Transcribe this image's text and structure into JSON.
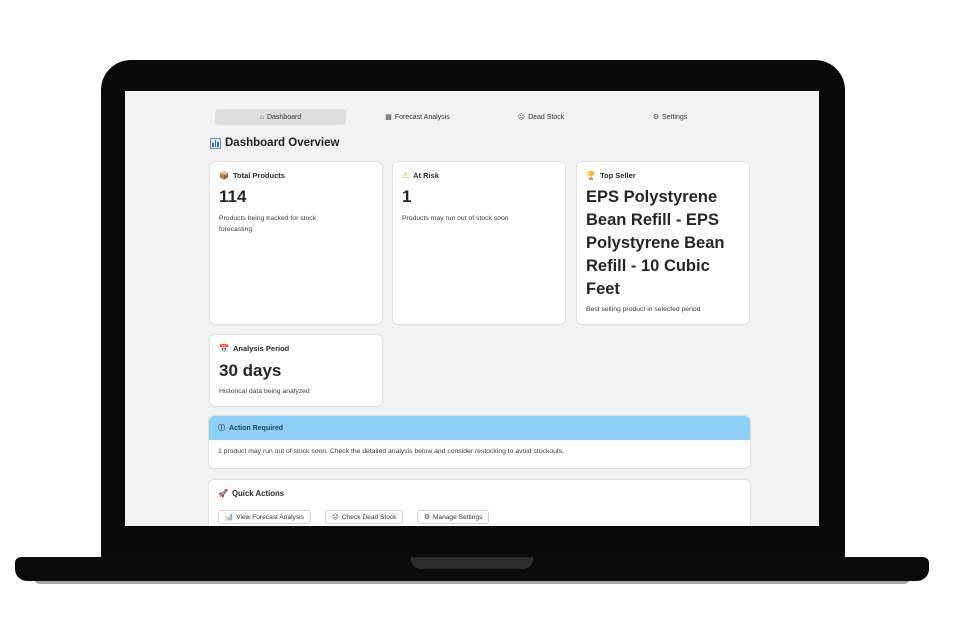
{
  "nav": {
    "tabs": [
      {
        "label": "Dashboard",
        "icon": "home-icon",
        "glyph": "⌂",
        "active": true
      },
      {
        "label": "Forecast Analysis",
        "icon": "chart-icon",
        "glyph": "▦",
        "active": false
      },
      {
        "label": "Dead Stock",
        "icon": "skull-icon",
        "glyph": "☹",
        "active": false
      },
      {
        "label": "Settings",
        "icon": "gear-icon",
        "glyph": "⚙",
        "active": false
      }
    ]
  },
  "page": {
    "title": "Dashboard Overview"
  },
  "cards": {
    "total_products": {
      "title": "Total Products",
      "icon": "package-icon",
      "glyph": "📦",
      "value": "114",
      "description": "Products being tracked for stock forecasting"
    },
    "at_risk": {
      "title": "At Risk",
      "icon": "warning-icon",
      "glyph": "⚠",
      "value": "1",
      "description": "Products may run out of stock soon"
    },
    "top_seller": {
      "title": "Top Seller",
      "icon": "trophy-icon",
      "glyph": "🏆",
      "value": "EPS Polystyrene Bean Refill - EPS Polystyrene Bean Refill - 10 Cubic Feet",
      "description": "Best selling product in selected period"
    },
    "analysis_period": {
      "title": "Analysis Period",
      "icon": "calendar-icon",
      "glyph": "📅",
      "value": "30 days",
      "description": "Historical data being analyzed"
    }
  },
  "alert": {
    "title": "Action Required",
    "icon": "info-icon",
    "glyph": "ⓘ",
    "message": "1 product may run out of stock soon. Check the detailed analysis below and consider restocking to avoid stockouts.",
    "header_color": "#8fd0f7"
  },
  "quick_actions": {
    "title": "Quick Actions",
    "icon": "rocket-icon",
    "glyph": "🚀",
    "buttons": [
      {
        "label": "View Forecast Analysis",
        "icon": "chart-icon",
        "glyph": "📊"
      },
      {
        "label": "Check Dead Stock",
        "icon": "skull-icon",
        "glyph": "☹"
      },
      {
        "label": "Manage Settings",
        "icon": "gear-icon",
        "glyph": "⚙"
      }
    ]
  }
}
